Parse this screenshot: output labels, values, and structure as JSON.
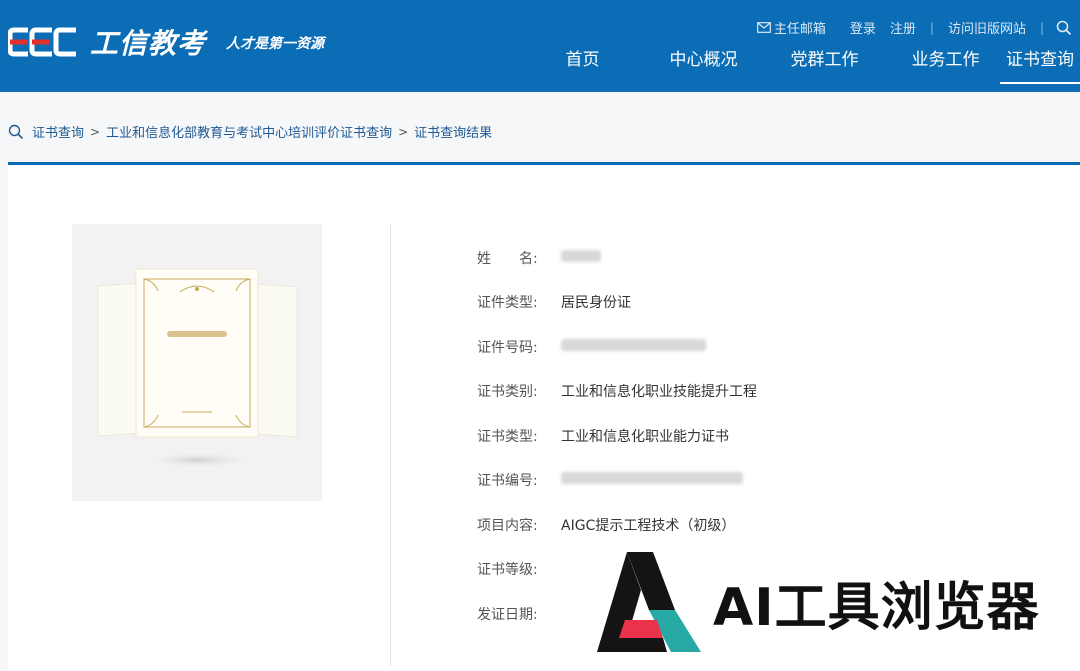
{
  "header": {
    "brand": "工信教考",
    "slogan": "人才是第一资源",
    "colors": {
      "header_bg": "#0b6db5",
      "logo_red": "#e2312d"
    },
    "top_links": {
      "mail": "主任邮箱",
      "login": "登录",
      "register": "注册",
      "old_site": "访问旧版网站"
    },
    "nav": [
      "首页",
      "中心概况",
      "党群工作",
      "业务工作",
      "证书查询"
    ],
    "nav_active": "证书查询"
  },
  "breadcrumb": [
    "证书查询",
    "工业和信息化部教育与考试中心培训评价证书查询",
    "证书查询结果"
  ],
  "certificate": {
    "fields": [
      {
        "label": "姓　　名:",
        "value": ""
      },
      {
        "label": "证件类型:",
        "value": "居民身份证"
      },
      {
        "label": "证件号码:",
        "value": ""
      },
      {
        "label": "证书类别:",
        "value": "工业和信息化职业技能提升工程"
      },
      {
        "label": "证书类型:",
        "value": "工业和信息化职业能力证书"
      },
      {
        "label": "证书编号:",
        "value": ""
      },
      {
        "label": "项目内容:",
        "value": "AIGC提示工程技术（初级）"
      },
      {
        "label": "证书等级:",
        "value": ""
      },
      {
        "label": "发证日期:",
        "value": ""
      }
    ]
  },
  "watermark": {
    "text": "AI工具浏览器",
    "colors": {
      "black": "#141414",
      "teal": "#27a9a6",
      "red": "#e8334a"
    }
  }
}
